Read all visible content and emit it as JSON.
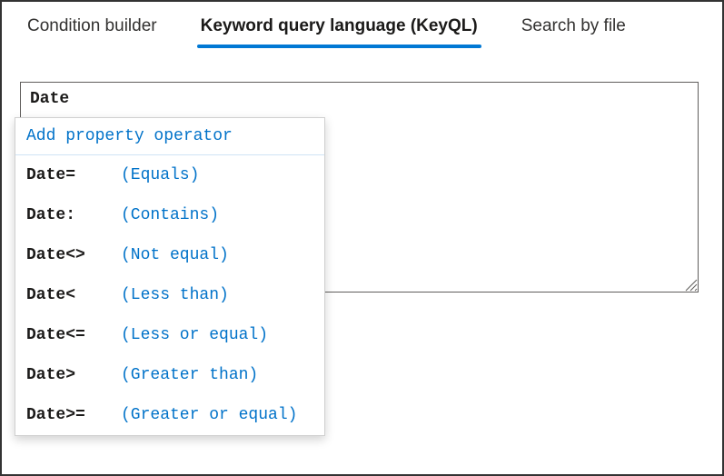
{
  "tabs": {
    "condition_builder": "Condition builder",
    "keyql": "Keyword query language (KeyQL)",
    "search_by_file": "Search by file"
  },
  "query_input": {
    "value": "Date"
  },
  "dropdown": {
    "header": "Add property operator",
    "items": [
      {
        "key": "Date=",
        "desc": "(Equals)"
      },
      {
        "key": "Date:",
        "desc": "(Contains)"
      },
      {
        "key": "Date<>",
        "desc": "(Not equal)"
      },
      {
        "key": "Date<",
        "desc": "(Less than)"
      },
      {
        "key": "Date<=",
        "desc": "(Less or equal)"
      },
      {
        "key": "Date>",
        "desc": "(Greater than)"
      },
      {
        "key": "Date>=",
        "desc": "(Greater or equal)"
      }
    ]
  }
}
